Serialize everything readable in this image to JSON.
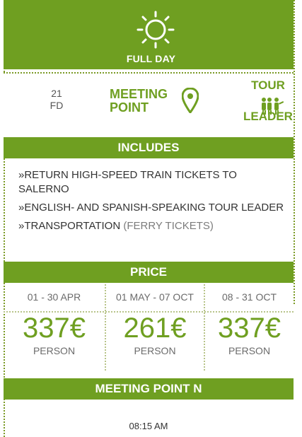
{
  "header": {
    "badge_label": "FULL DAY",
    "icon": "sun-icon",
    "colors": {
      "accent": "#6f9f21",
      "text": "#ffffff"
    }
  },
  "summary": {
    "code_line1": "21",
    "code_line2": "FD",
    "meeting_point_label_line1": "MEETING",
    "meeting_point_label_line2": "POINT",
    "meeting_icon": "map-pin-icon",
    "tour_label_line1": "TOUR",
    "tour_label_line2": "LEADER",
    "tour_icon": "group-icon"
  },
  "includes": {
    "title": "INCLUDES",
    "items": [
      {
        "text": "RETURN HIGH-SPEED TRAIN TICKETS TO SALERNO",
        "light": ""
      },
      {
        "text": "ENGLISH- AND SPANISH-SPEAKING TOUR LEADER",
        "light": ""
      },
      {
        "text": "TRANSPORTATION",
        "light": " (FERRY TICKETS)"
      }
    ]
  },
  "price": {
    "title": "PRICE",
    "columns": [
      {
        "period": "01 - 30 APR",
        "amount": "337€",
        "per": "PERSON"
      },
      {
        "period": "01 MAY - 07 OCT",
        "amount": "261€",
        "per": "PERSON"
      },
      {
        "period": "08 - 31 OCT",
        "amount": "337€",
        "per": "PERSON"
      }
    ]
  },
  "meeting": {
    "title": "MEETING POINT N",
    "time": "08:15 AM"
  }
}
